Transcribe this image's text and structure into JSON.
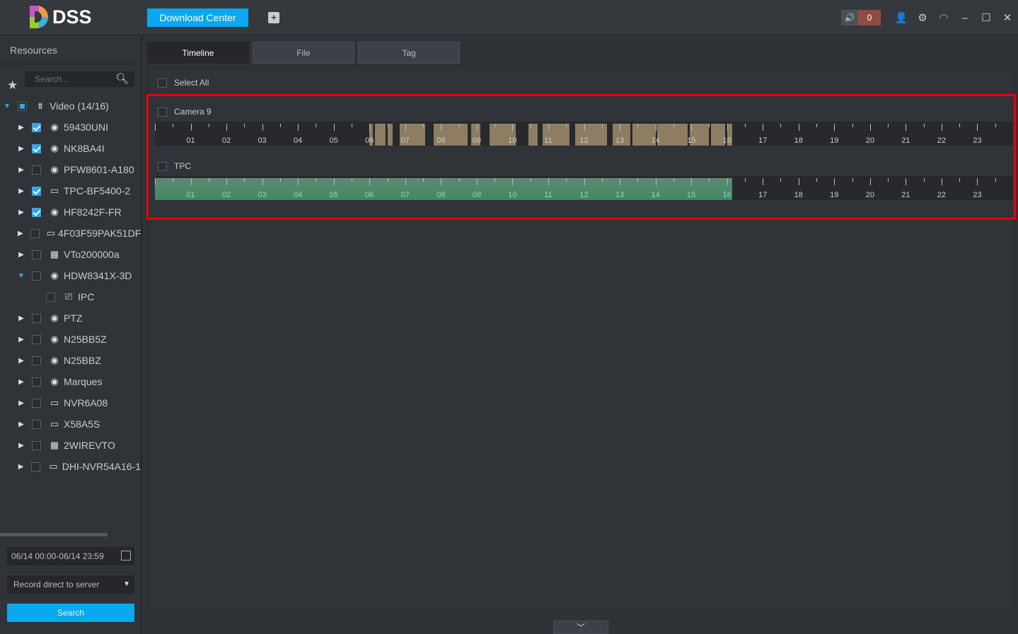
{
  "header": {
    "logo": "DSS",
    "download_center": "Download Center",
    "alarm_count": "0"
  },
  "sidebar": {
    "title": "Resources",
    "search_placeholder": "Search...",
    "tree": [
      {
        "label": "Video (14/16)",
        "level": 0,
        "arrow": "open",
        "check": "part",
        "icon": "org"
      },
      {
        "label": "59430UNI",
        "level": 1,
        "arrow": "closed",
        "check": "on",
        "icon": "camera"
      },
      {
        "label": "NK8BA4I",
        "level": 1,
        "arrow": "closed",
        "check": "on",
        "icon": "camera"
      },
      {
        "label": "PFW8601-A180",
        "level": 1,
        "arrow": "closed",
        "check": "off",
        "icon": "camera"
      },
      {
        "label": "TPC-BF5400-2",
        "level": 1,
        "arrow": "closed",
        "check": "on",
        "icon": "nvr"
      },
      {
        "label": "HF8242F-FR",
        "level": 1,
        "arrow": "closed",
        "check": "on",
        "icon": "camera"
      },
      {
        "label": "4F03F59PAK51DF",
        "level": 1,
        "arrow": "closed",
        "check": "off",
        "icon": "nvr"
      },
      {
        "label": "VTo200000a",
        "level": 1,
        "arrow": "closed",
        "check": "off",
        "icon": "vto"
      },
      {
        "label": "HDW8341X-3D",
        "level": 1,
        "arrow": "open",
        "check": "off",
        "icon": "camera"
      },
      {
        "label": "IPC",
        "level": 2,
        "arrow": "none",
        "check": "off",
        "icon": "ipc"
      },
      {
        "label": "PTZ",
        "level": 1,
        "arrow": "closed",
        "check": "off",
        "icon": "camera"
      },
      {
        "label": "N25BB5Z",
        "level": 1,
        "arrow": "closed",
        "check": "off",
        "icon": "camera"
      },
      {
        "label": "N25BBZ",
        "level": 1,
        "arrow": "closed",
        "check": "off",
        "icon": "camera"
      },
      {
        "label": "Marques",
        "level": 1,
        "arrow": "closed",
        "check": "off",
        "icon": "camera"
      },
      {
        "label": "NVR6A08",
        "level": 1,
        "arrow": "closed",
        "check": "off",
        "icon": "nvr"
      },
      {
        "label": "X58A5S",
        "level": 1,
        "arrow": "closed",
        "check": "off",
        "icon": "nvr"
      },
      {
        "label": "2WIREVTO",
        "level": 1,
        "arrow": "closed",
        "check": "off",
        "icon": "vto"
      },
      {
        "label": "DHI-NVR54A16-1",
        "level": 1,
        "arrow": "closed",
        "check": "off",
        "icon": "nvr"
      }
    ],
    "date_range": "06/14 00:00-06/14 23:59",
    "record_type": "Record direct to server",
    "search_button": "Search"
  },
  "tabs": [
    {
      "label": "Timeline",
      "active": true
    },
    {
      "label": "File",
      "active": false
    },
    {
      "label": "Tag",
      "active": false
    }
  ],
  "main": {
    "select_all": "Select All",
    "hour_labels": [
      "01",
      "02",
      "03",
      "04",
      "05",
      "06",
      "07",
      "08",
      "09",
      "10",
      "11",
      "12",
      "13",
      "14",
      "15",
      "16",
      "17",
      "18",
      "19",
      "20",
      "21",
      "22",
      "23"
    ],
    "channels": [
      {
        "name": "Camera 9",
        "type": "segments",
        "color": "#8c7d63",
        "segments": [
          [
            6.0,
            6.1
          ],
          [
            6.15,
            6.45
          ],
          [
            6.5,
            6.65
          ],
          [
            6.85,
            7.55
          ],
          [
            7.8,
            8.75
          ],
          [
            8.85,
            9.1
          ],
          [
            9.35,
            10.1
          ],
          [
            10.45,
            10.7
          ],
          [
            10.85,
            11.6
          ],
          [
            11.75,
            12.65
          ],
          [
            12.8,
            13.3
          ],
          [
            13.35,
            14.0
          ],
          [
            14.05,
            14.9
          ],
          [
            14.95,
            15.5
          ],
          [
            15.55,
            15.95
          ],
          [
            16.0,
            16.15
          ]
        ]
      },
      {
        "name": "TPC",
        "type": "green",
        "color": "#3e8a62",
        "segments": [
          [
            0,
            16.15
          ]
        ]
      }
    ]
  }
}
